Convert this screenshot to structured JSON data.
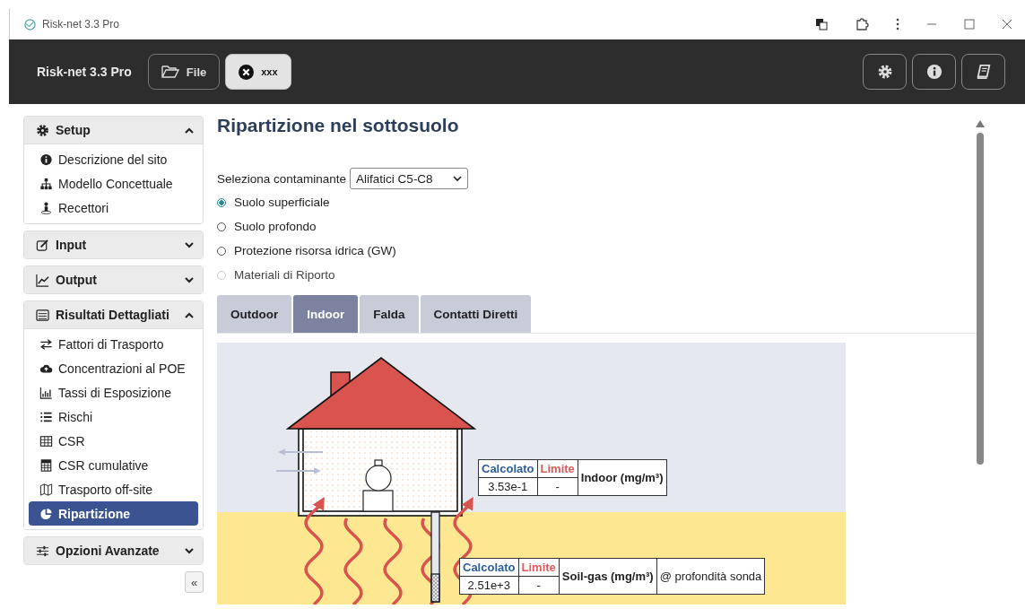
{
  "window": {
    "title": "Risk-net 3.3 Pro"
  },
  "header": {
    "app_name": "Risk-net 3.3 Pro",
    "buttons": [
      {
        "kind": "folder",
        "label": "File",
        "selected": false
      },
      {
        "kind": "close",
        "label": "xxx",
        "selected": true
      }
    ]
  },
  "sidebar": {
    "sections": [
      {
        "kind": "gear",
        "title": "Setup",
        "expanded": true,
        "items": [
          {
            "kind": "info",
            "label": "Descrizione del sito",
            "selected": false
          },
          {
            "kind": "sitemap",
            "label": "Modello Concettuale",
            "selected": false
          },
          {
            "kind": "person",
            "label": "Recettori",
            "selected": false
          }
        ]
      },
      {
        "kind": "edit",
        "title": "Input",
        "expanded": false
      },
      {
        "kind": "line-chart",
        "title": "Output",
        "expanded": false
      },
      {
        "kind": "list-box",
        "title": "Risultati Dettagliati",
        "expanded": true,
        "items": [
          {
            "kind": "exchange",
            "label": "Fattori di Trasporto",
            "selected": false
          },
          {
            "kind": "cloud",
            "label": "Concentrazioni al POE",
            "selected": false
          },
          {
            "kind": "bar-chart",
            "label": "Tassi di Esposizione",
            "selected": false
          },
          {
            "kind": "list",
            "label": "Rischi",
            "selected": false
          },
          {
            "kind": "table",
            "label": "CSR",
            "selected": false
          },
          {
            "kind": "calculator",
            "label": "CSR cumulative",
            "selected": false
          },
          {
            "kind": "map",
            "label": "Trasporto off-site",
            "selected": false
          },
          {
            "kind": "pie",
            "label": "Ripartizione",
            "selected": true
          }
        ]
      },
      {
        "kind": "sliders",
        "title": "Opzioni Avanzate",
        "expanded": false
      }
    ],
    "collapse": "«"
  },
  "main": {
    "title": "Ripartizione nel sottosuolo",
    "contaminant": {
      "label": "Seleziona contaminante",
      "value": "Alifatici C5-C8"
    },
    "radios": [
      {
        "label": "Suolo superficiale",
        "selected": true,
        "disabled": false
      },
      {
        "label": "Suolo profondo",
        "selected": false,
        "disabled": false
      },
      {
        "label": "Protezione risorsa idrica (GW)",
        "selected": false,
        "disabled": false
      },
      {
        "label": "Materiali di Riporto",
        "selected": false,
        "disabled": true
      }
    ],
    "tabs": [
      {
        "label": "Outdoor",
        "selected": false
      },
      {
        "label": "Indoor",
        "selected": true
      },
      {
        "label": "Falda",
        "selected": false
      },
      {
        "label": "Contatti Diretti",
        "selected": false
      }
    ],
    "diagram": {
      "tables": [
        {
          "kind": "indoor",
          "calc_header": "Calcolato",
          "limit_header": "Limite",
          "calc_value": "3.53e-1",
          "limit_value": "-",
          "label": "Indoor (mg/m³)"
        },
        {
          "kind": "soil-gas",
          "calc_header": "Calcolato",
          "limit_header": "Limite",
          "calc_value": "2.51e+3",
          "limit_value": "-",
          "label": "Soil-gas (mg/m³)",
          "note": "@ profondità sonda"
        }
      ]
    }
  }
}
